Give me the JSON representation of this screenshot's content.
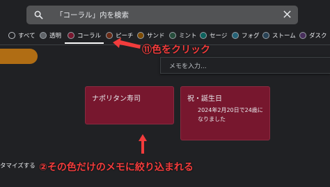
{
  "search": {
    "text": "「コーラル」内を検索",
    "icon": "search-icon",
    "clear_icon": "close-icon"
  },
  "color_filters": [
    {
      "label": "すべて",
      "color": "#202124",
      "selected": false
    },
    {
      "label": "透明",
      "color": "#5f6368",
      "selected": false
    },
    {
      "label": "コーラル",
      "color": "#77172e",
      "selected": true
    },
    {
      "label": "ピーチ",
      "color": "#692b17",
      "selected": false
    },
    {
      "label": "サンド",
      "color": "#7c4a03",
      "selected": false
    },
    {
      "label": "ミント",
      "color": "#264d3b",
      "selected": false
    },
    {
      "label": "セージ",
      "color": "#0c625d",
      "selected": false
    },
    {
      "label": "フォグ",
      "color": "#256377",
      "selected": false
    },
    {
      "label": "ストーム",
      "color": "#284255",
      "selected": false
    },
    {
      "label": "ダスク",
      "color": "#472e5b",
      "selected": false
    }
  ],
  "annotations": {
    "step1": "⑪色をクリック",
    "step2": "②その色だけのメモに絞り込まれる",
    "accent_color": "#f23c3c"
  },
  "memo_input": {
    "placeholder": "メモを入力..."
  },
  "notes": [
    {
      "title": "ナポリタン寿司",
      "body": ""
    },
    {
      "title": "祝・誕生日",
      "body": "2024年2月20日で24歳になりました"
    }
  ],
  "sidebar_partial": {
    "customize_label": "タマイズする"
  }
}
